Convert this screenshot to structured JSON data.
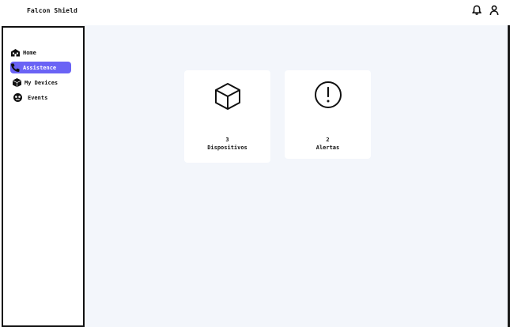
{
  "app": {
    "title": "Falcon Shield"
  },
  "header": {
    "icons": [
      "bell-icon",
      "user-icon"
    ]
  },
  "sidebar": {
    "items": [
      {
        "label": "Home",
        "icon": "home-icon",
        "active": false
      },
      {
        "label": "Assistence",
        "icon": "phone-icon",
        "active": true
      },
      {
        "label": "My Devices",
        "icon": "box-icon",
        "active": false
      },
      {
        "label": "Events",
        "icon": "event-icon",
        "active": false
      }
    ]
  },
  "cards": [
    {
      "count": "3",
      "label": "Dispositivos",
      "icon": "box-icon"
    },
    {
      "count": "2",
      "label": "Alertas",
      "icon": "alert-icon"
    }
  ],
  "colors": {
    "accent": "#6a63f5",
    "main_bg": "#f3f6fb"
  }
}
